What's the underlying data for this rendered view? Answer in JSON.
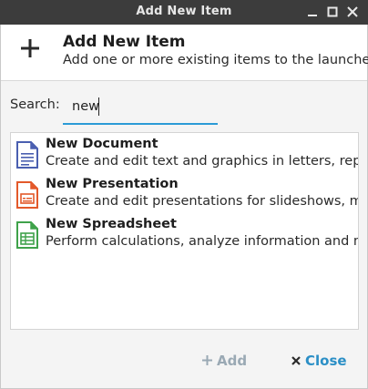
{
  "window": {
    "title": "Add New Item",
    "controls": [
      "minimize-icon",
      "maximize-icon",
      "close-icon"
    ]
  },
  "header": {
    "icon": "plus-icon",
    "title": "Add New Item",
    "subtitle": "Add one or more existing items to the launcher"
  },
  "search": {
    "label": "Search:",
    "value": "new"
  },
  "items": [
    {
      "name": "New Document",
      "description": "Create and edit text and graphics in letters, reports, documents and Web pages.",
      "icon": "writer-document-icon",
      "accent": "#4a5fb0"
    },
    {
      "name": "New Presentation",
      "description": "Create and edit presentations for slideshows, meeting and Web pages.",
      "icon": "impress-presentation-icon",
      "accent": "#e3592a"
    },
    {
      "name": "New Spreadsheet",
      "description": "Perform calculations, analyze information and manage lists in spreadsheets.",
      "icon": "calc-spreadsheet-icon",
      "accent": "#3fa24a"
    }
  ],
  "footer": {
    "add_label": "Add",
    "add_icon": "plus-icon",
    "close_label": "Close",
    "close_icon": "close-icon"
  },
  "colors": {
    "titlebar": "#3c3c3c",
    "accent": "#2b9bd6",
    "disabled": "#9aa9b4"
  }
}
